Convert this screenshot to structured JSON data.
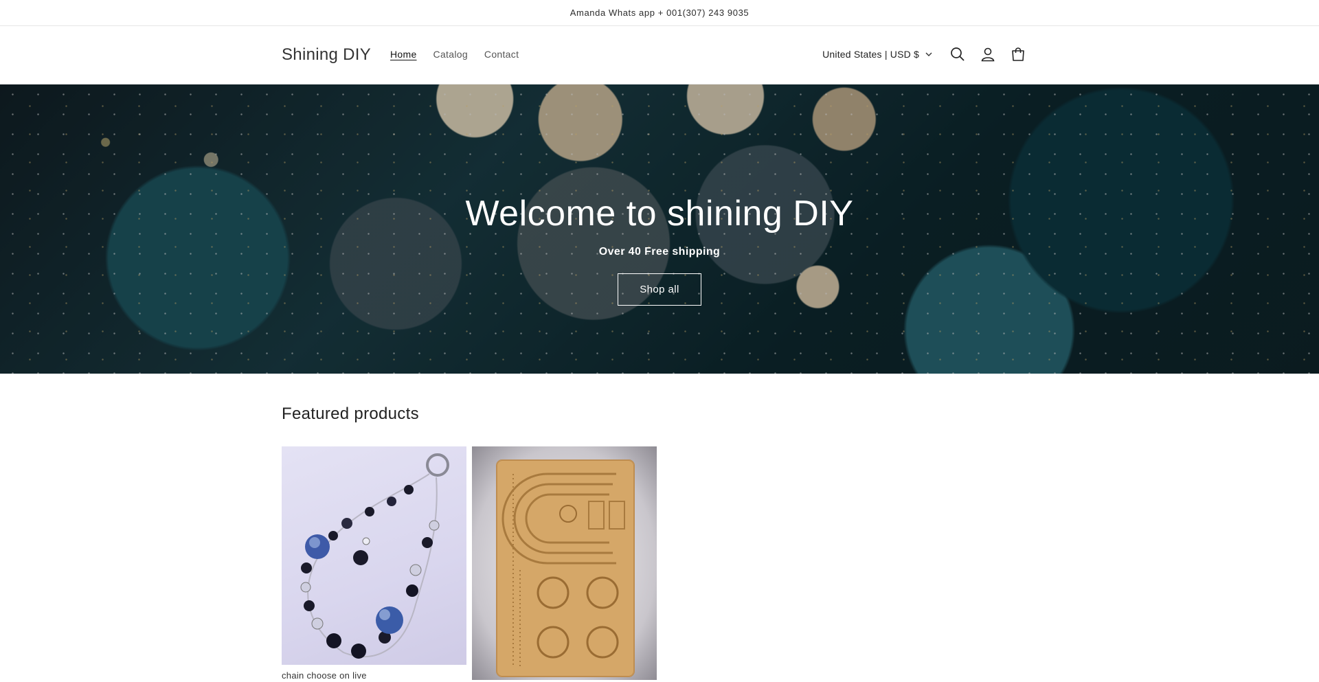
{
  "announcement": {
    "text": "Amanda Whats app + 001(307) 243 9035"
  },
  "header": {
    "logo": "Shining DIY",
    "nav": [
      {
        "label": "Home",
        "active": true
      },
      {
        "label": "Catalog",
        "active": false
      },
      {
        "label": "Contact",
        "active": false
      }
    ],
    "country_selector": "United States | USD $",
    "icons": [
      "search-icon",
      "account-icon",
      "cart-icon"
    ]
  },
  "hero": {
    "title": "Welcome to shining DIY",
    "subtitle": "Over 40 Free shipping",
    "button_label": "Shop all"
  },
  "featured": {
    "title": "Featured products",
    "products": [
      {
        "name": "chain choose on live"
      },
      {
        "name": ""
      }
    ]
  },
  "colors": {
    "text": "#121212",
    "border": "#e6e6e6",
    "hero_text": "#ffffff"
  }
}
